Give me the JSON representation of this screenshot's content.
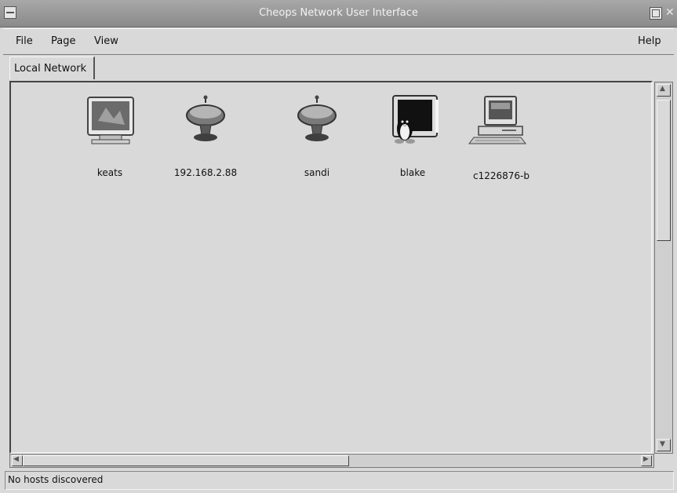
{
  "window": {
    "title": "Cheops Network User Interface"
  },
  "menubar": {
    "items": [
      "File",
      "Page",
      "View"
    ],
    "help": "Help"
  },
  "tabs": [
    {
      "label": "Local Network",
      "active": true
    }
  ],
  "hosts": [
    {
      "label": "keats",
      "icon": "monitor-icon"
    },
    {
      "label": "192.168.2.88",
      "icon": "globe-icon"
    },
    {
      "label": "sandi",
      "icon": "globe-icon"
    },
    {
      "label": "blake",
      "icon": "linux-penguin-icon"
    },
    {
      "label": "c1226876-b",
      "icon": "desktop-computer-icon"
    }
  ],
  "status": {
    "text": "No hosts discovered"
  }
}
